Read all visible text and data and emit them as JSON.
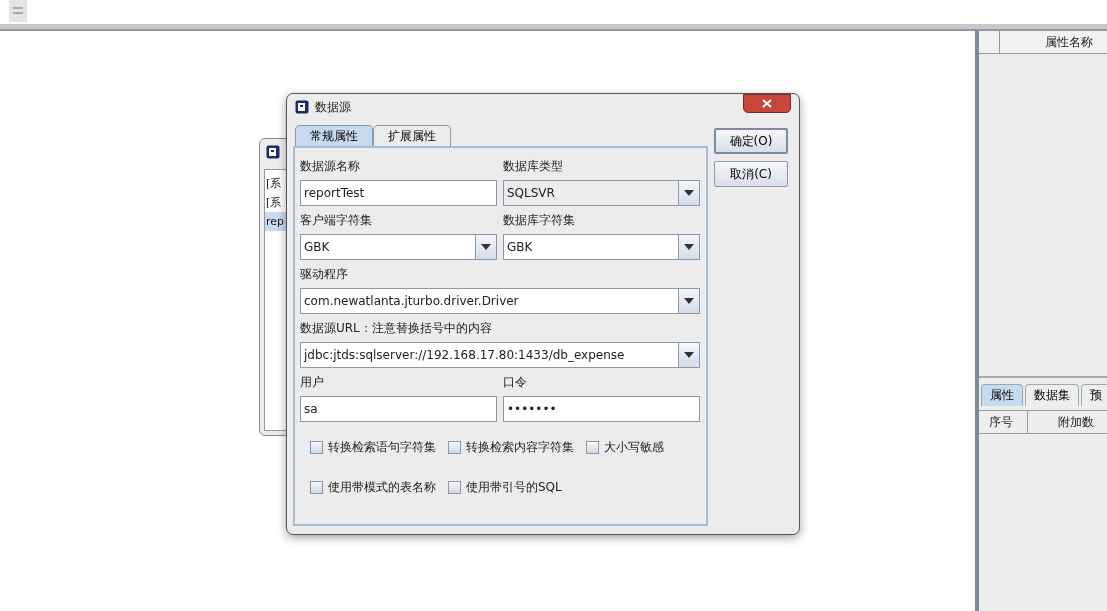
{
  "back_window": {
    "items": [
      {
        "label": "[系",
        "selected": false
      },
      {
        "label": "[系",
        "selected": false
      },
      {
        "label": "rep",
        "selected": true
      }
    ]
  },
  "dialog": {
    "title": "数据源",
    "tabs": [
      {
        "label": "常规属性",
        "selected": true
      },
      {
        "label": "扩展属性",
        "selected": false
      }
    ],
    "rows": [
      {
        "fields": [
          {
            "kind": "text",
            "label": "数据源名称",
            "value": "reportTest",
            "disabled": false
          },
          {
            "kind": "combo",
            "label": "数据库类型",
            "value": "SQLSVR",
            "disabled": true
          }
        ]
      },
      {
        "fields": [
          {
            "kind": "combo",
            "label": "客户端字符集",
            "value": "GBK",
            "disabled": false
          },
          {
            "kind": "combo",
            "label": "数据库字符集",
            "value": "GBK",
            "disabled": false
          }
        ]
      },
      {
        "fields": [
          {
            "kind": "combo",
            "label": "驱动程序",
            "value": "com.newatlanta.jturbo.driver.Driver",
            "disabled": false
          }
        ]
      },
      {
        "fields": [
          {
            "kind": "combo",
            "label": "数据源URL：注意替换括号中的内容",
            "value": "jdbc:jtds:sqlserver://192.168.17.80:1433/db_expense",
            "disabled": false
          }
        ]
      },
      {
        "fields": [
          {
            "kind": "text",
            "label": "用户",
            "value": "sa",
            "disabled": false
          },
          {
            "kind": "text",
            "label": "口令",
            "value": "•••••••",
            "disabled": false
          }
        ]
      }
    ],
    "checkbox_rows": [
      [
        {
          "label": "转换检索语句字符集",
          "checked": false
        },
        {
          "label": "转换检索内容字符集",
          "checked": false
        },
        {
          "label": "大小写敏感",
          "checked": false
        }
      ],
      [
        {
          "label": "使用带模式的表名称",
          "checked": false
        },
        {
          "label": "使用带引号的SQL",
          "checked": false
        }
      ]
    ],
    "buttons": [
      {
        "label": "确定(O)",
        "focused": true
      },
      {
        "label": "取消(C)",
        "focused": false
      }
    ]
  },
  "right_panel": {
    "top_columns": [
      "属性名称"
    ],
    "tabs": [
      {
        "label": "属性",
        "selected": true
      },
      {
        "label": "数据集",
        "selected": false
      },
      {
        "label": "预",
        "selected": false
      }
    ],
    "bottom_columns": [
      "序号",
      "附加数"
    ]
  }
}
